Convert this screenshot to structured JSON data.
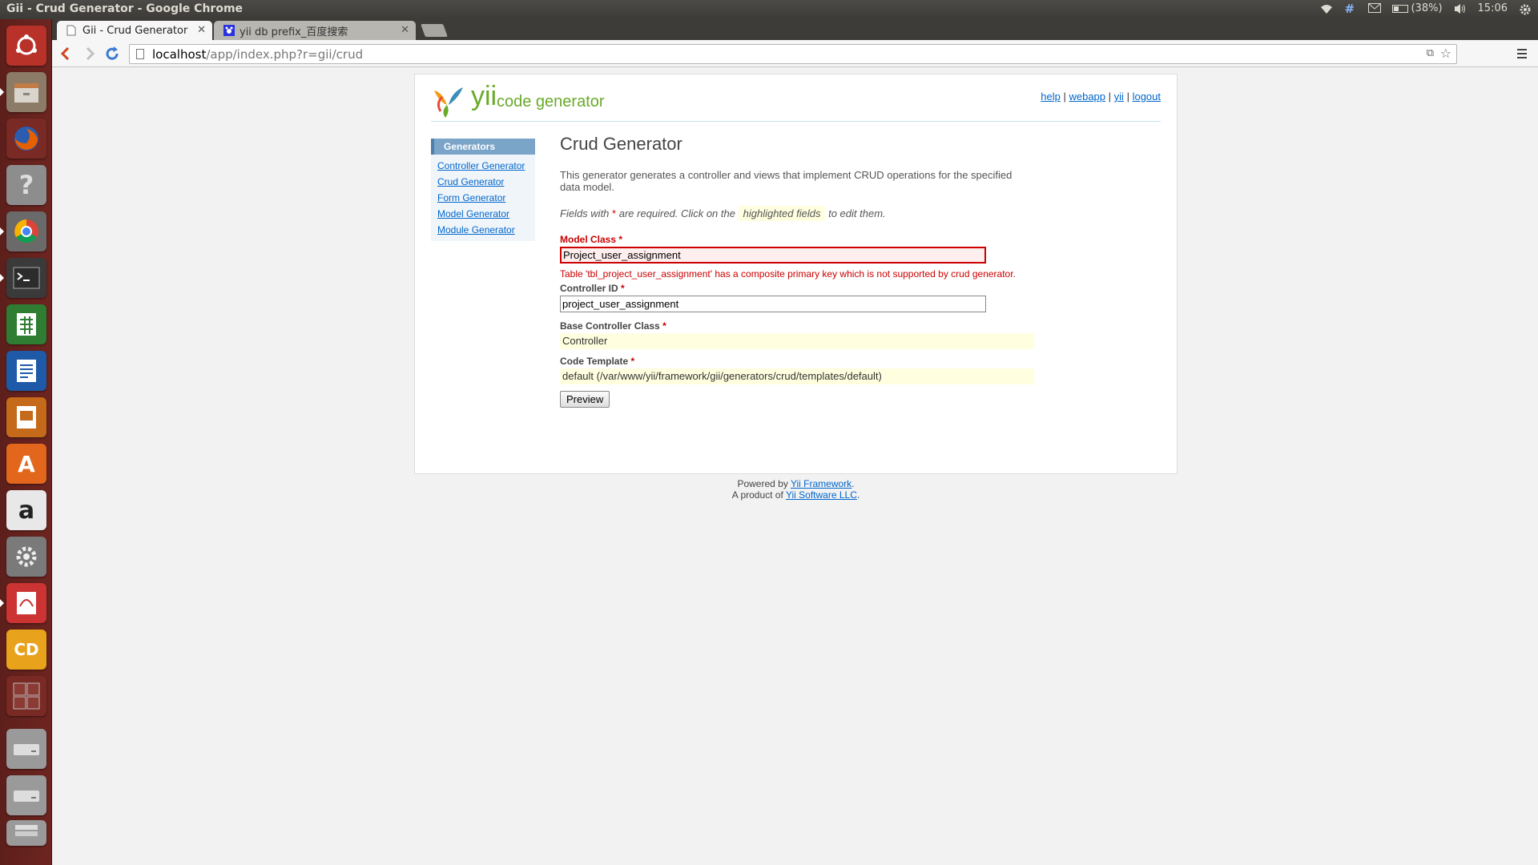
{
  "os": {
    "window_title": "Gii - Crud Generator - Google Chrome",
    "battery": "(38%)",
    "clock": "15:06",
    "launcher_icons": [
      "ubuntu-dash-icon",
      "files-icon",
      "firefox-icon",
      "help-icon",
      "chrome-icon",
      "terminal-icon",
      "spreadsheet-icon",
      "writer-icon",
      "impress-icon",
      "software-center-icon",
      "amazon-icon",
      "system-settings-icon",
      "pdf-viewer-icon",
      "cd-icon",
      "workspace-switcher-icon",
      "drive-icon",
      "drive-icon",
      "trash-icon"
    ],
    "colors": {
      "panel": "#3c3b37",
      "launcher": "#6e2520"
    }
  },
  "browser": {
    "tabs": [
      {
        "label": "Gii - Crud Generator",
        "active": true
      },
      {
        "label": "yii db prefix_百度搜索",
        "active": false
      }
    ],
    "url_host": "localhost",
    "url_path": "/app/index.php?r=gii/crud"
  },
  "header": {
    "logo_yii": "yii",
    "logo_text": "code generator",
    "links": [
      "help",
      "webapp",
      "yii",
      "logout"
    ],
    "separator": "|"
  },
  "sidebar": {
    "title": "Generators",
    "items": [
      "Controller Generator",
      "Crud Generator",
      "Form Generator",
      "Model Generator",
      "Module Generator"
    ]
  },
  "main": {
    "title": "Crud Generator",
    "description": "This generator generates a controller and views that implement CRUD operations for the specified data model.",
    "note_prefix": "Fields with",
    "note_star": "*",
    "note_mid": "are required. Click on the",
    "note_highlight": "highlighted fields",
    "note_suffix": "to edit them.",
    "fields": {
      "model_class": {
        "label": "Model Class",
        "value": "Project_user_assignment",
        "error": "Table 'tbl_project_user_assignment' has a composite primary key which is not supported by crud generator."
      },
      "controller_id": {
        "label": "Controller ID",
        "value": "project_user_assignment"
      },
      "base_controller_class": {
        "label": "Base Controller Class",
        "value": "Controller"
      },
      "code_template": {
        "label": "Code Template",
        "value": "default (/var/www/yii/framework/gii/generators/crud/templates/default)"
      }
    },
    "required_star": "*",
    "preview_button": "Preview"
  },
  "footer": {
    "powered_by": "Powered by",
    "framework_link": "Yii Framework",
    "product_of": "A product of",
    "company_link": "Yii Software LLC",
    "period": "."
  }
}
